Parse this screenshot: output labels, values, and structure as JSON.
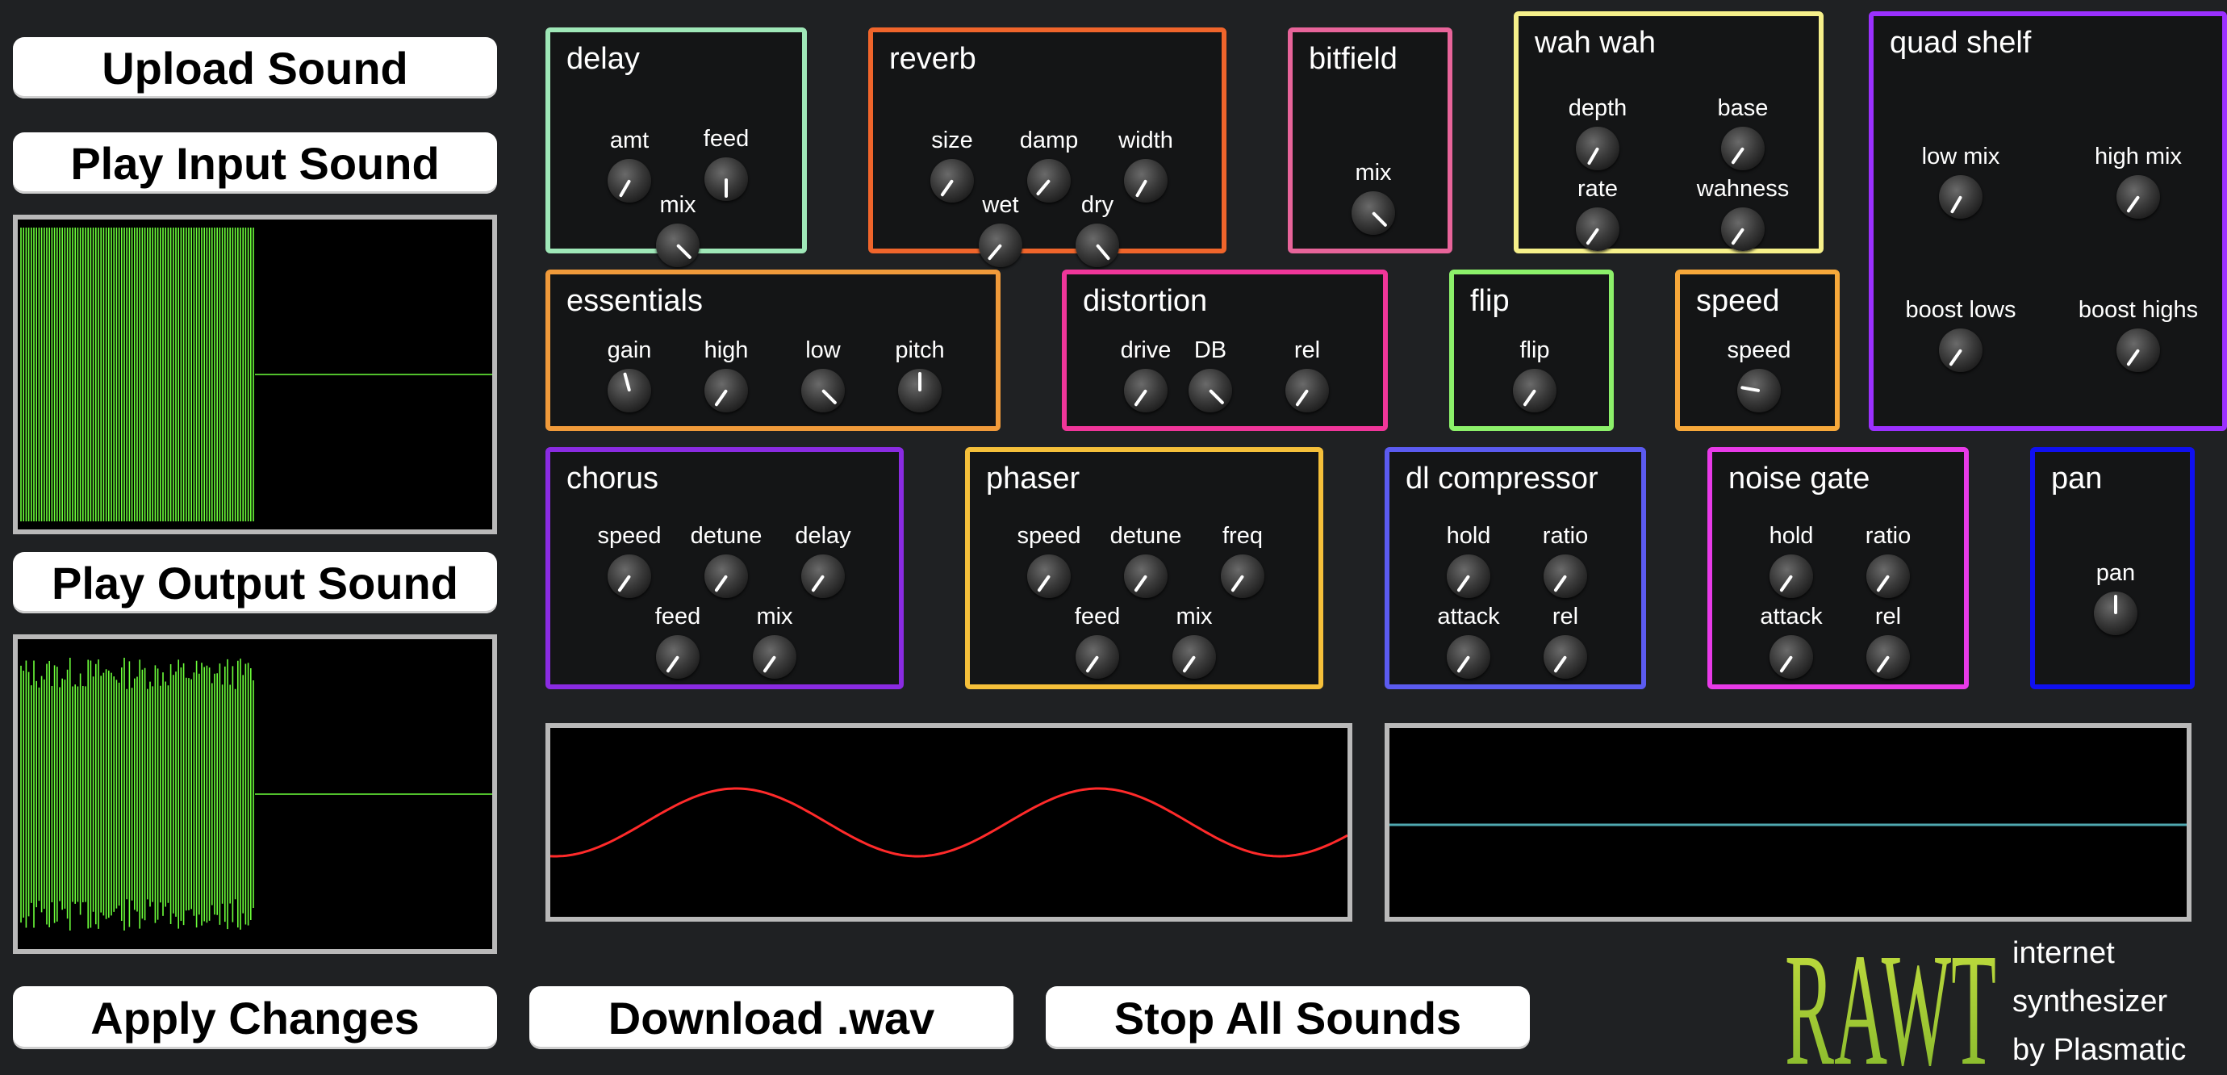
{
  "buttons": {
    "upload": "Upload Sound",
    "play_input": "Play Input Sound",
    "play_output": "Play Output Sound",
    "apply": "Apply Changes",
    "download": "Download .wav",
    "stop_all": "Stop All Sounds"
  },
  "colors": {
    "background": "#1f2123",
    "waveform_green": "#6cff3a",
    "lfo_red": "#ff2a2a",
    "flat_line": "#4fa8b0",
    "delay": "#9fe8b8",
    "reverb": "#f0652b",
    "bitfield": "#e8649a",
    "wahwah": "#f6f08a",
    "quad_shelf": "#9b30ff",
    "essentials": "#f09a3a",
    "distortion": "#f0369a",
    "flip": "#8cf06a",
    "speed": "#f7a83a",
    "chorus": "#8a2be2",
    "phaser": "#f5c03a",
    "dl_compressor": "#5b5bf0",
    "noise_gate": "#e83ae8",
    "pan": "#1010f0"
  },
  "panels": {
    "delay": {
      "title": "delay",
      "knobs": [
        "amt",
        "feed",
        "mix"
      ]
    },
    "reverb": {
      "title": "reverb",
      "knobs": [
        "size",
        "damp",
        "width",
        "wet",
        "dry"
      ]
    },
    "bitfield": {
      "title": "bitfield",
      "knobs": [
        "mix"
      ]
    },
    "wahwah": {
      "title": "wah wah",
      "knobs": [
        "depth",
        "base",
        "rate",
        "wahness"
      ]
    },
    "quad_shelf": {
      "title": "quad shelf",
      "knobs": [
        "low mix",
        "high mix",
        "boost lows",
        "boost highs"
      ]
    },
    "essentials": {
      "title": "essentials",
      "knobs": [
        "gain",
        "high",
        "low",
        "pitch"
      ]
    },
    "distortion": {
      "title": "distortion",
      "knobs": [
        "drive",
        "DB",
        "rel"
      ]
    },
    "flip": {
      "title": "flip",
      "knobs": [
        "flip"
      ]
    },
    "speed": {
      "title": "speed",
      "knobs": [
        "speed"
      ]
    },
    "chorus": {
      "title": "chorus",
      "knobs": [
        "speed",
        "detune",
        "delay",
        "feed",
        "mix"
      ]
    },
    "phaser": {
      "title": "phaser",
      "knobs": [
        "speed",
        "detune",
        "freq",
        "feed",
        "mix"
      ]
    },
    "dl_compressor": {
      "title": "dl compressor",
      "knobs": [
        "hold",
        "ratio",
        "attack",
        "rel"
      ]
    },
    "noise_gate": {
      "title": "noise gate",
      "knobs": [
        "hold",
        "ratio",
        "attack",
        "rel"
      ]
    },
    "pan": {
      "title": "pan",
      "knobs": [
        "pan"
      ]
    }
  },
  "logo": {
    "wordmark": "RAWT",
    "line1": "internet",
    "line2": "synthesizer",
    "line3": "by Plasmatic"
  },
  "icons": {
    "knob": "rotary-knob-icon"
  }
}
